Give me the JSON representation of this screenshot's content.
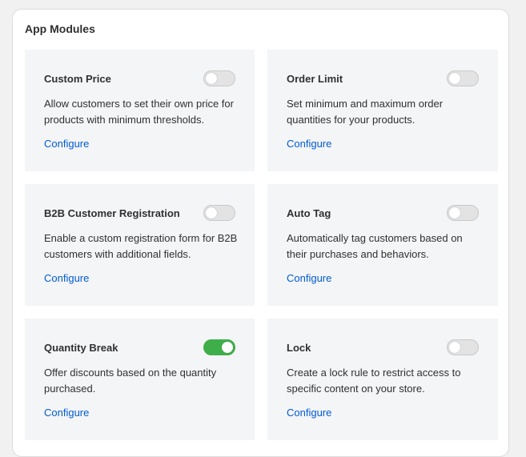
{
  "panel": {
    "title": "App Modules"
  },
  "accent": {
    "toggle_on": "#3eae4a",
    "toggle_off": "#e3e3e3",
    "link": "#005bd3"
  },
  "modules": [
    {
      "title": "Custom Price",
      "description": "Allow customers to set their own price for products with minimum thresholds.",
      "link": "Configure",
      "enabled": false
    },
    {
      "title": "Order Limit",
      "description": "Set minimum and maximum order quantities for your products.",
      "link": "Configure",
      "enabled": false
    },
    {
      "title": "B2B Customer Registration",
      "description": "Enable a custom registration form for B2B customers with additional fields.",
      "link": "Configure",
      "enabled": false
    },
    {
      "title": "Auto Tag",
      "description": "Automatically tag customers based on their purchases and behaviors.",
      "link": "Configure",
      "enabled": false
    },
    {
      "title": "Quantity Break",
      "description": "Offer discounts based on the quantity purchased.",
      "link": "Configure",
      "enabled": true
    },
    {
      "title": "Lock",
      "description": "Create a lock rule to restrict access to specific content on your store.",
      "link": "Configure",
      "enabled": false
    }
  ]
}
